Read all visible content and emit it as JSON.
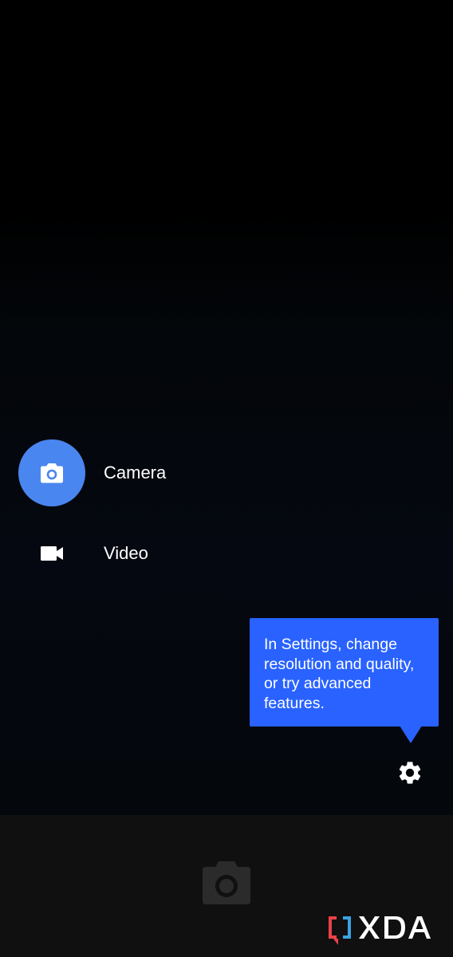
{
  "modes": {
    "camera": {
      "label": "Camera",
      "icon": "camera-icon",
      "selected": true
    },
    "video": {
      "label": "Video",
      "icon": "videocam-icon",
      "selected": false
    }
  },
  "tooltip": {
    "text": "In Settings, change resolution and quality, or try advanced features."
  },
  "settings": {
    "icon": "gear-icon"
  },
  "shutter": {
    "icon": "camera-shutter-icon",
    "state": "disabled"
  },
  "watermark": {
    "text": "XDA"
  },
  "colors": {
    "accent": "#4a86ef",
    "tooltip": "#2962ff",
    "background": "#000000",
    "bottom_bar": "#101010",
    "text": "#ffffff"
  }
}
